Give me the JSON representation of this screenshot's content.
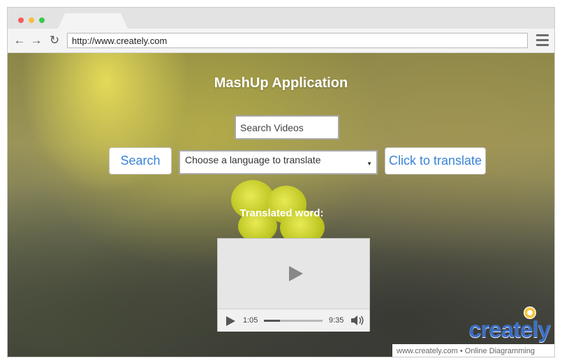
{
  "browser": {
    "url": "http://www.creately.com"
  },
  "app": {
    "title": "MashUp Application",
    "search_placeholder": "Search Videos",
    "search_button": "Search",
    "language_select": "Choose a language to translate",
    "translate_button": "Click to translate",
    "translated_label": "Translated word:"
  },
  "video": {
    "current_time": "1:05",
    "total_time": "9:35",
    "progress": 0.27
  },
  "watermark": {
    "logo": "creately",
    "footer": "www.creately.com • Online Diagramming"
  },
  "colors": {
    "accent": "#3a84d6",
    "logo": "#3b6fc8"
  },
  "icons": [
    "back-arrow-icon",
    "forward-arrow-icon",
    "reload-icon",
    "hamburger-menu-icon",
    "play-icon",
    "volume-icon",
    "chevron-down-icon",
    "lightbulb-icon"
  ]
}
